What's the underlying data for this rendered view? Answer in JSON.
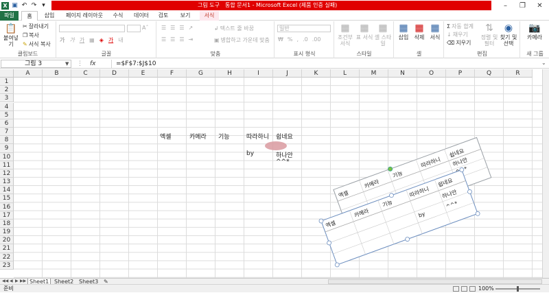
{
  "titlebar": {
    "contextual_label": "그림 도구",
    "title": "통합 문서1 - Microsoft Excel (제품 인증 실패)"
  },
  "tabs": [
    "파일",
    "홈",
    "삽입",
    "페이지 레이아웃",
    "수식",
    "데이터",
    "검토",
    "보기",
    "서식"
  ],
  "ribbon": {
    "clipboard": {
      "label": "클립보드",
      "paste": "붙여넣기",
      "cut": "잘라내기",
      "copy": "복사",
      "format_painter": "서식 복사"
    },
    "font": {
      "label": "글꼴"
    },
    "alignment": {
      "label": "맞춤",
      "wrap": "텍스트 줄 바꿈",
      "merge": "병합하고 가운데 맞춤"
    },
    "number": {
      "label": "표시 형식",
      "format": "일반"
    },
    "styles": {
      "label": "스타일",
      "conditional": "조건부 서식",
      "table": "표 서식",
      "cell": "셀 스타일"
    },
    "cells": {
      "label": "셀",
      "insert": "삽입",
      "delete": "삭제",
      "format": "서식"
    },
    "editing": {
      "label": "편집",
      "autosum": "자동 합계",
      "fill": "채우기",
      "clear": "지우기",
      "sort": "정렬 및 필터",
      "find": "찾기 및 선택"
    },
    "camera": {
      "label": "새 그룹",
      "button": "카메라"
    }
  },
  "formula_bar": {
    "name_box": "그림 3",
    "fx": "fx",
    "formula": "=$F$7:$J$10"
  },
  "columns": [
    "A",
    "B",
    "C",
    "D",
    "E",
    "F",
    "G",
    "H",
    "I",
    "J",
    "K",
    "L",
    "M",
    "N",
    "O",
    "P",
    "Q",
    "R"
  ],
  "rows": [
    "1",
    "2",
    "3",
    "4",
    "5",
    "6",
    "7",
    "8",
    "9",
    "10",
    "11",
    "12",
    "13",
    "14",
    "15",
    "16",
    "17",
    "18",
    "19",
    "20",
    "21",
    "22",
    "23"
  ],
  "cells": {
    "F7": "엑셀",
    "G7": "카메라",
    "H7": "기능",
    "I7": "따라하니",
    "J7": "쉽네요",
    "I9": "by",
    "J9": "하나안",
    "J10": "^^*"
  },
  "sheets": [
    "Sheet1",
    "Sheet2",
    "Sheet3"
  ],
  "status": {
    "ready": "준비",
    "zoom": "100%"
  },
  "picture1": {
    "r1": [
      "엑셀",
      "카메라",
      "기능",
      "따라하니",
      "쉽네요"
    ],
    "by": "by",
    "name": "하나안",
    "smile": "^^*"
  },
  "picture2": {
    "r1": [
      "엑셀",
      "카메라",
      "기능",
      "따라하니",
      "쉽네요"
    ],
    "by": "by",
    "name": "하나안",
    "smile": "^^*"
  }
}
